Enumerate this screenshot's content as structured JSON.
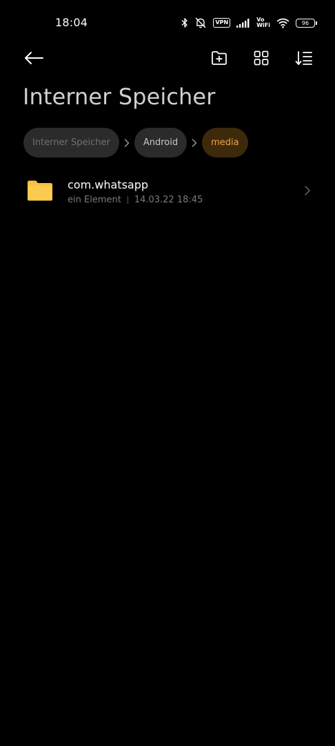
{
  "status_bar": {
    "time": "18:04",
    "vpn_label": "VPN",
    "vowifi_top": "Vo",
    "vowifi_bottom": "WiFi",
    "battery_level": "96",
    "icons": [
      "bluetooth-icon",
      "muted-bell-icon",
      "vpn-icon",
      "signal-icon",
      "vowifi-icon",
      "wifi-icon",
      "battery-icon"
    ]
  },
  "toolbar": {
    "icons": [
      "back-arrow-icon",
      "new-folder-icon",
      "grid-view-icon",
      "sort-icon"
    ]
  },
  "page": {
    "title": "Interner Speicher"
  },
  "breadcrumb": {
    "items": [
      {
        "label": "Interner Speicher"
      },
      {
        "label": "Android"
      },
      {
        "label": "media"
      }
    ]
  },
  "files": [
    {
      "name": "com.whatsapp",
      "count": "ein Element",
      "modified": "14.03.22 18:45",
      "icon": "folder-icon"
    }
  ],
  "colors": {
    "background": "#000000",
    "accent": "#f2a24a",
    "folder": "#f7c144"
  }
}
